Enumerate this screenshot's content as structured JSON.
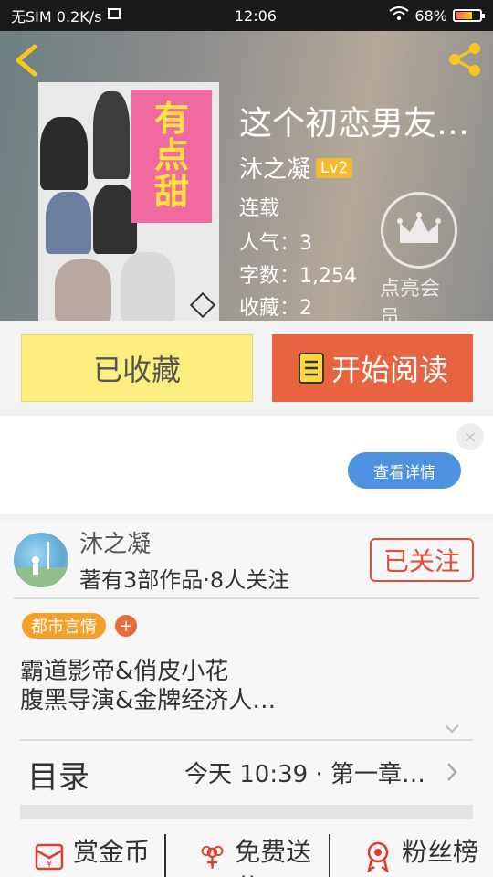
{
  "status_bar": {
    "carrier": "无SIM 0.2K/s",
    "time": "12:06",
    "battery": "68%",
    "battery_level": 0.68
  },
  "book": {
    "title": "这个初恋男友有…",
    "cover_title": [
      "有",
      "点",
      "甜"
    ],
    "author": "沐之凝",
    "level": "Lv2",
    "status": "连载",
    "popularity_label": "人气：",
    "popularity": "3",
    "word_count_label": "字数：",
    "word_count": "1,254",
    "favorites_label": "收藏：",
    "favorites": "2"
  },
  "vip": {
    "label": "点亮会员"
  },
  "actions": {
    "favorited_label": "已收藏",
    "read_label": "开始阅读"
  },
  "ad": {
    "close_label": "×",
    "detail_label": "查看详情"
  },
  "writer": {
    "name": "沐之凝",
    "stats": "著有3部作品·8人关注",
    "follow_label": "已关注"
  },
  "tags": {
    "items": [
      "都市言情"
    ],
    "add_label": "+"
  },
  "description": {
    "line1": "霸道影帝&俏皮小花",
    "line2": "腹黑导演&金牌经济人…"
  },
  "toc": {
    "label": "目录",
    "latest": "今天 10:39 · 第一章…"
  },
  "bottom_bar": {
    "items": [
      {
        "label": "赏金币",
        "icon": "red-envelope-icon"
      },
      {
        "label": "免费送花",
        "icon": "flower-icon"
      },
      {
        "label": "粉丝榜",
        "icon": "medal-icon"
      }
    ]
  },
  "colors": {
    "read_button": "#e8633f",
    "favorite_button": "#fbee7e",
    "follow_accent": "#e44b3b",
    "tag": "#f5a028",
    "detail_button": "#4f92e0"
  }
}
